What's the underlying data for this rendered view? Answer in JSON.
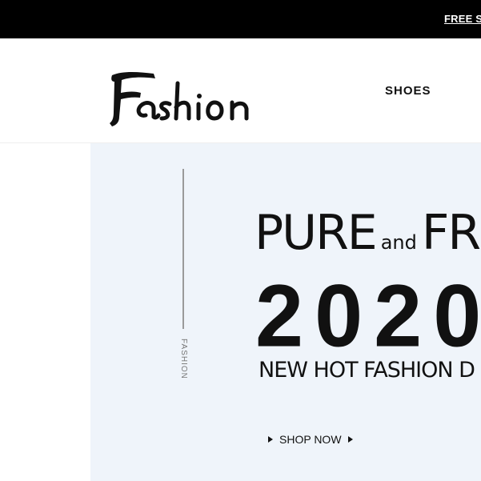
{
  "promo_bar": {
    "text": "FREE S"
  },
  "header": {
    "logo_text": "Fashion",
    "nav": {
      "shoes": "SHOES"
    }
  },
  "hero": {
    "side_label": "FASHION",
    "headline_big_1": "PURE",
    "headline_small": "and",
    "headline_big_2": "FR",
    "year": "2020",
    "subline": "NEW HOT FASHION D",
    "cta": "SHOP NOW"
  },
  "colors": {
    "promo_background": "#000000",
    "hero_background": "#eff4fa",
    "text": "#111111"
  }
}
